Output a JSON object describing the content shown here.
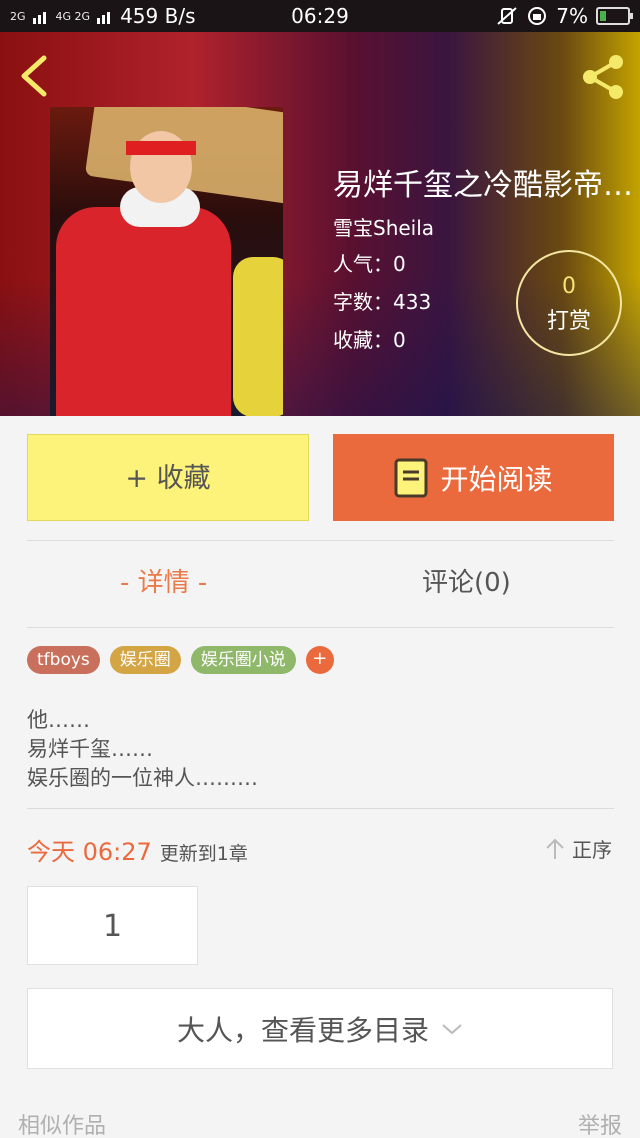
{
  "status_bar": {
    "signal1": "2G",
    "signal2": "4G 2G",
    "speed": "459 B/s",
    "time": "06:29",
    "battery": "7%",
    "battery_fill": 0.07
  },
  "header": {
    "back_icon": "chevron-left-icon",
    "share_icon": "share-icon"
  },
  "book": {
    "title": "易烊千玺之冷酷影帝…",
    "author": "雪宝Sheila",
    "popularity": "人气：0",
    "word_count": "字数：433",
    "favorites": "收藏：0",
    "reward_count": "0",
    "reward_label": "打赏"
  },
  "actions": {
    "favorite_label": "+ 收藏",
    "read_label": "开始阅读"
  },
  "tabs": {
    "detail": "- 详情 -",
    "comment": "评论(0)"
  },
  "tags": [
    {
      "label": "tfboys",
      "color": "#c9705c"
    },
    {
      "label": "娱乐圈",
      "color": "#d4a545"
    },
    {
      "label": "娱乐圈小说",
      "color": "#8fb86a"
    }
  ],
  "tag_add": "+",
  "description": [
    "他……",
    "易烊千玺……",
    "娱乐圈的一位神人………"
  ],
  "update": {
    "today": "今天 06:27",
    "text": "更新到1章",
    "order": "正序"
  },
  "chapters": [
    "1"
  ],
  "more_catalog": "大人，查看更多目录",
  "footer": {
    "similar": "相似作品",
    "report": "举报"
  },
  "colors": {
    "accent": "#ea6a3e",
    "favorite_button": "#fdf27a"
  }
}
